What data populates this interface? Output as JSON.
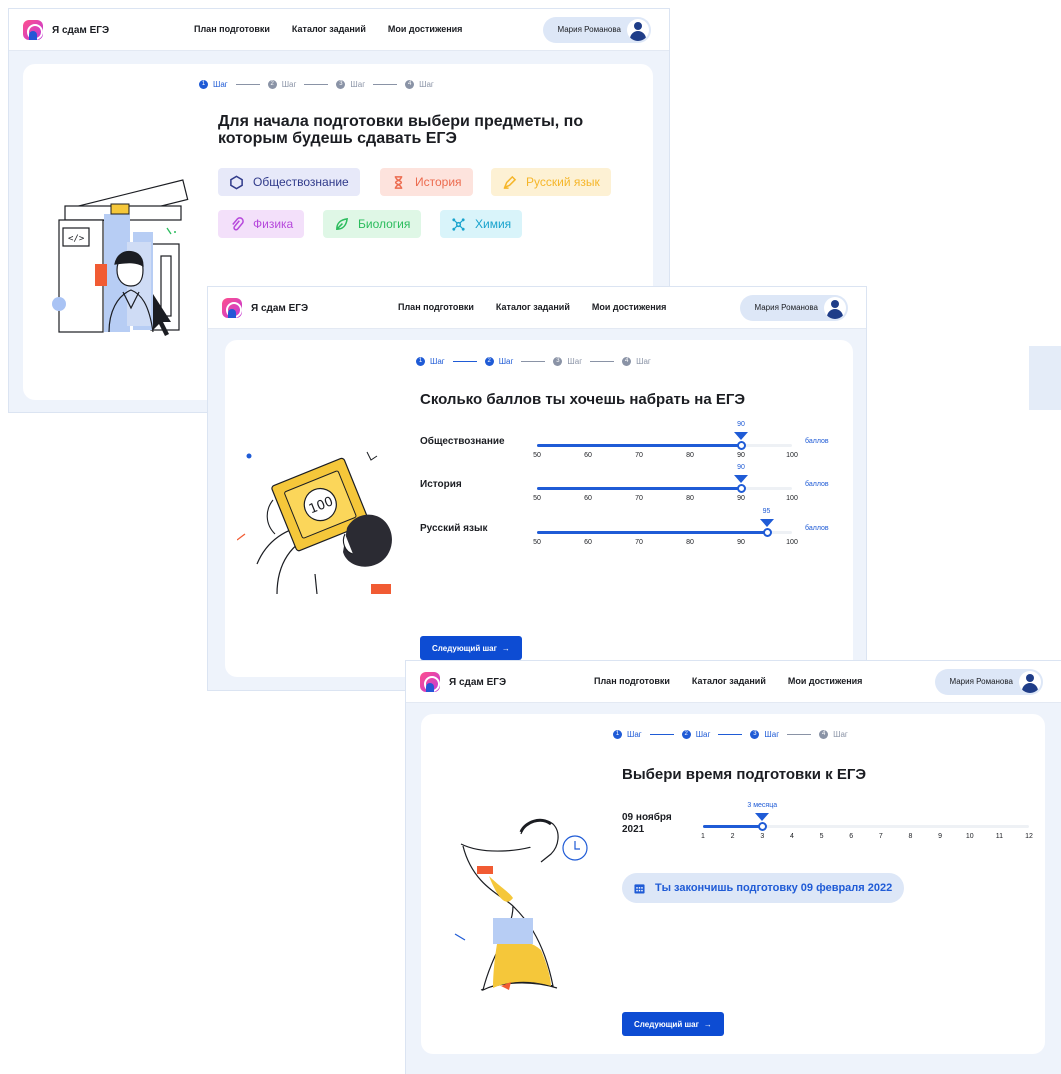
{
  "app": {
    "logo_text": "Я сдам ЕГЭ",
    "nav": [
      "План подготовки",
      "Каталог заданий",
      "Мои достижения"
    ],
    "user_name": "Мария Романова"
  },
  "steps": {
    "label": "Шаг",
    "numbers": [
      "1",
      "2",
      "3",
      "4"
    ]
  },
  "screen1": {
    "active_step": 1,
    "heading_line1": "Для начала подготовки выбери предметы, по",
    "heading_line2": "которым будешь сдавать ЕГЭ",
    "subjects": [
      {
        "label": "Обществознание",
        "icon": "hexagon-icon",
        "bg": "#e7e9f9",
        "fg": "#303a8a"
      },
      {
        "label": "История",
        "icon": "hourglass-icon",
        "bg": "#fde3dd",
        "fg": "#ec6b4f"
      },
      {
        "label": "Русский язык",
        "icon": "pen-icon",
        "bg": "#fdf1d4",
        "fg": "#f5b62a"
      },
      {
        "label": "Физика",
        "icon": "paperclip-icon",
        "bg": "#f3e0fa",
        "fg": "#b648dc"
      },
      {
        "label": "Биология",
        "icon": "leaf-icon",
        "bg": "#dff7e6",
        "fg": "#2bbc5d"
      },
      {
        "label": "Химия",
        "icon": "molecule-icon",
        "bg": "#d9f4fa",
        "fg": "#18a3cd"
      }
    ]
  },
  "screen2": {
    "active_step": 2,
    "heading": "Сколько баллов ты хочешь набрать на ЕГЭ",
    "scale_ticks": [
      "50",
      "60",
      "70",
      "80",
      "90",
      "100"
    ],
    "scale_min": 50,
    "scale_max": 100,
    "unit": "баллов",
    "subjects": [
      {
        "label": "Обществознание",
        "value": 90,
        "value_text": "90"
      },
      {
        "label": "История",
        "value": 90,
        "value_text": "90"
      },
      {
        "label": "Русский язык",
        "value": 95,
        "value_text": "95"
      }
    ],
    "next_button": "Следующий шаг"
  },
  "screen3": {
    "active_step": 3,
    "heading": "Выбери время подготовки к ЕГЭ",
    "date_line1": "09 ноября",
    "date_line2": "2021",
    "months_ticks": [
      "1",
      "2",
      "3",
      "4",
      "5",
      "6",
      "7",
      "8",
      "9",
      "10",
      "11",
      "12"
    ],
    "months_value": 3,
    "value_text": "3 месяца",
    "finish_text": "Ты закончишь подготовку 09 февраля 2022",
    "next_button": "Следующий шаг"
  },
  "colors": {
    "primary": "#0d4cd3",
    "accent_blue": "#1f5bd6",
    "light_blue": "#dde7f7"
  }
}
